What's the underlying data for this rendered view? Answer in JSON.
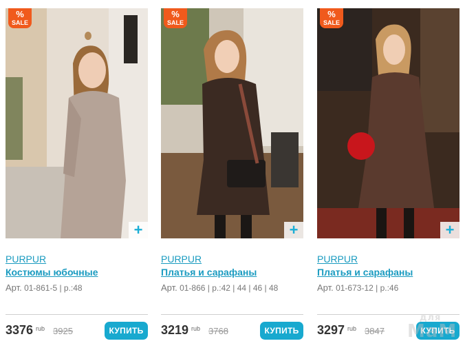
{
  "products": [
    {
      "brand": "PURPUR",
      "name": "Костюмы юбочные",
      "article_label": "Арт.",
      "article_rest": " 01-861-5 | р.:48",
      "price": "3376",
      "currency": "rub",
      "old_price": "3925",
      "buy_label": "КУПИТЬ",
      "sale_pct": "%",
      "sale_label": "SALE",
      "plus_label": "+"
    },
    {
      "brand": "PURPUR",
      "name": "Платья и сарафаны",
      "article_label": "Арт.",
      "article_rest": " 01-866 | р.:42 | 44 | 46 | 48",
      "price": "3219",
      "currency": "rub",
      "old_price": "3768",
      "buy_label": "КУПИТЬ",
      "sale_pct": "%",
      "sale_label": "SALE",
      "plus_label": "+"
    },
    {
      "brand": "PURPUR",
      "name": "Платья и сарафаны",
      "article_label": "Арт.",
      "article_rest": " 01-673-12 | р.:46",
      "price": "3297",
      "currency": "rub",
      "old_price": "3847",
      "buy_label": "КУПИТЬ",
      "sale_pct": "%",
      "sale_label": "SALE",
      "plus_label": "+"
    }
  ],
  "watermark": {
    "top": "для",
    "bottom": "МаМ"
  },
  "colors": {
    "accent": "#1aa9cf",
    "sale": "#f05a1c",
    "link": "#1a9bc0"
  }
}
